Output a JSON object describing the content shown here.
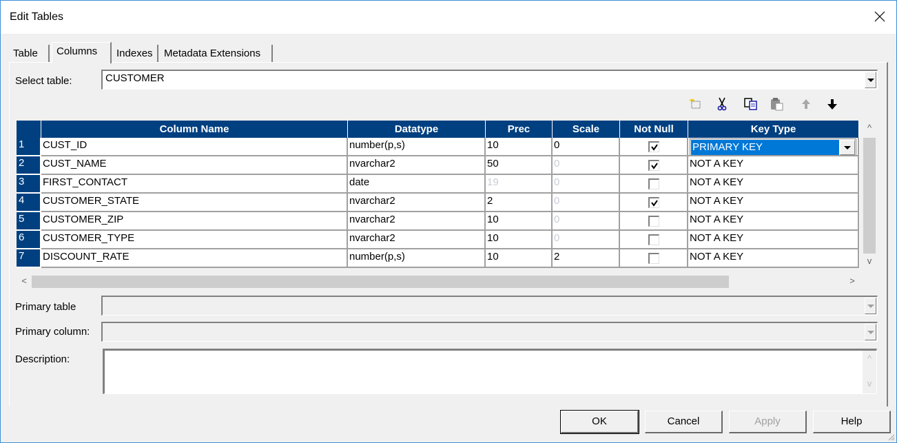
{
  "window": {
    "title": "Edit Tables",
    "close_icon": "close-icon"
  },
  "tabs": [
    {
      "label": "Table",
      "active": false
    },
    {
      "label": "Columns",
      "active": true
    },
    {
      "label": "Indexes",
      "active": false
    },
    {
      "label": "Metadata Extensions",
      "active": false
    }
  ],
  "select_table": {
    "label": "Select table:",
    "value": "CUSTOMER"
  },
  "toolbar": {
    "icons": [
      "new-column-icon",
      "cut-icon",
      "copy-icon",
      "paste-icon",
      "move-up-icon",
      "move-down-icon"
    ]
  },
  "grid": {
    "headers": [
      "Column Name",
      "Datatype",
      "Prec",
      "Scale",
      "Not Null",
      "Key Type"
    ],
    "rows": [
      {
        "num": "1",
        "name": "CUST_ID",
        "datatype": "number(p,s)",
        "prec": "10",
        "prec_dim": false,
        "scale": "0",
        "scale_dim": false,
        "not_null": true,
        "key_type": "PRIMARY KEY",
        "editing": true
      },
      {
        "num": "2",
        "name": "CUST_NAME",
        "datatype": "nvarchar2",
        "prec": "50",
        "prec_dim": false,
        "scale": "0",
        "scale_dim": true,
        "not_null": true,
        "key_type": "NOT A KEY",
        "editing": false
      },
      {
        "num": "3",
        "name": "FIRST_CONTACT",
        "datatype": "date",
        "prec": "19",
        "prec_dim": true,
        "scale": "0",
        "scale_dim": true,
        "not_null": false,
        "key_type": "NOT A KEY",
        "editing": false
      },
      {
        "num": "4",
        "name": "CUSTOMER_STATE",
        "datatype": "nvarchar2",
        "prec": "2",
        "prec_dim": false,
        "scale": "0",
        "scale_dim": true,
        "not_null": true,
        "key_type": "NOT A KEY",
        "editing": false
      },
      {
        "num": "5",
        "name": "CUSTOMER_ZIP",
        "datatype": "nvarchar2",
        "prec": "10",
        "prec_dim": false,
        "scale": "0",
        "scale_dim": true,
        "not_null": false,
        "key_type": "NOT A KEY",
        "editing": false
      },
      {
        "num": "6",
        "name": "CUSTOMER_TYPE",
        "datatype": "nvarchar2",
        "prec": "10",
        "prec_dim": false,
        "scale": "0",
        "scale_dim": true,
        "not_null": false,
        "key_type": "NOT A KEY",
        "editing": false
      },
      {
        "num": "7",
        "name": "DISCOUNT_RATE",
        "datatype": "number(p,s)",
        "prec": "10",
        "prec_dim": false,
        "scale": "2",
        "scale_dim": false,
        "not_null": false,
        "key_type": "NOT A KEY",
        "editing": false
      }
    ]
  },
  "primary_table": {
    "label": "Primary table",
    "value": ""
  },
  "primary_column": {
    "label": "Primary column:",
    "value": ""
  },
  "description": {
    "label": "Description:",
    "value": ""
  },
  "buttons": {
    "ok": "OK",
    "cancel": "Cancel",
    "apply": "Apply",
    "help": "Help"
  },
  "scroll": {
    "up": "^",
    "down": "v",
    "left": "<",
    "right": ">"
  },
  "colors": {
    "header_bg": "#004080",
    "selection": "#0078d7",
    "window_border": "#3c8fd6"
  }
}
